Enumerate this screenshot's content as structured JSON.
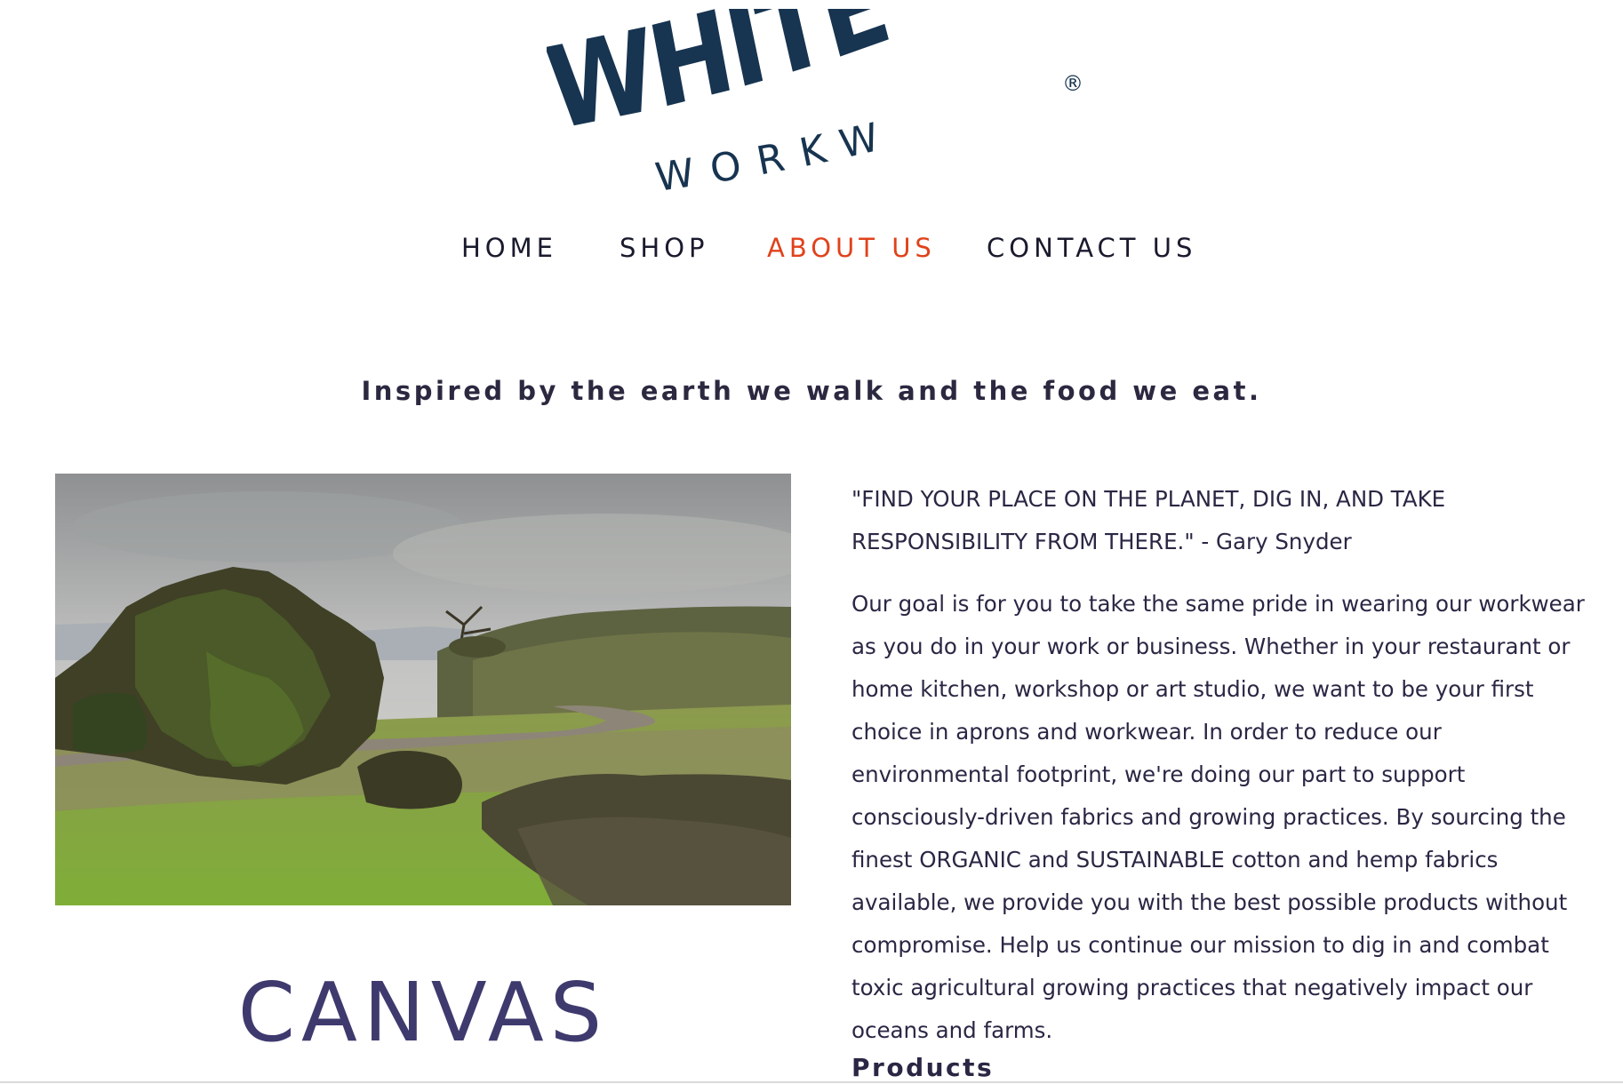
{
  "brand": {
    "logo_main": "WHITEBARK",
    "logo_sub": "WORKWEAR",
    "registered_mark": "®",
    "logo_color": "#173450"
  },
  "nav": {
    "items": [
      {
        "label": "HOME",
        "active": false
      },
      {
        "label": "SHOP",
        "active": false
      },
      {
        "label": "ABOUT US",
        "active": true
      },
      {
        "label": "CONTACT US",
        "active": false
      }
    ],
    "active_color": "#e0421b",
    "default_color": "#1a1a2e"
  },
  "tagline": "Inspired by the earth we walk and the food we eat.",
  "hero": {
    "image_icon": "landscape-photo",
    "caption_heading": "CANVAS"
  },
  "quote": "\"FIND YOUR PLACE ON THE PLANET, DIG IN, AND TAKE RESPONSIBILITY FROM THERE.\" - Gary Snyder",
  "body": "Our goal is for you to take the same pride in wearing our workwear as you do in your work or business. Whether in your restaurant or home kitchen, workshop or art studio, we want to be your first choice in aprons and workwear. In order to reduce our environmental footprint, we're doing our part to support consciously-driven fabrics and growing practices. By sourcing the finest ORGANIC and SUSTAINABLE cotton and hemp fabrics available, we provide you with the best possible products without compromise. Help us continue our mission to dig in and combat toxic agricultural growing practices that negatively impact our oceans and farms.",
  "products_heading": "Products",
  "colors": {
    "heading_purple": "#3e3a6e",
    "text": "#2a2744"
  }
}
